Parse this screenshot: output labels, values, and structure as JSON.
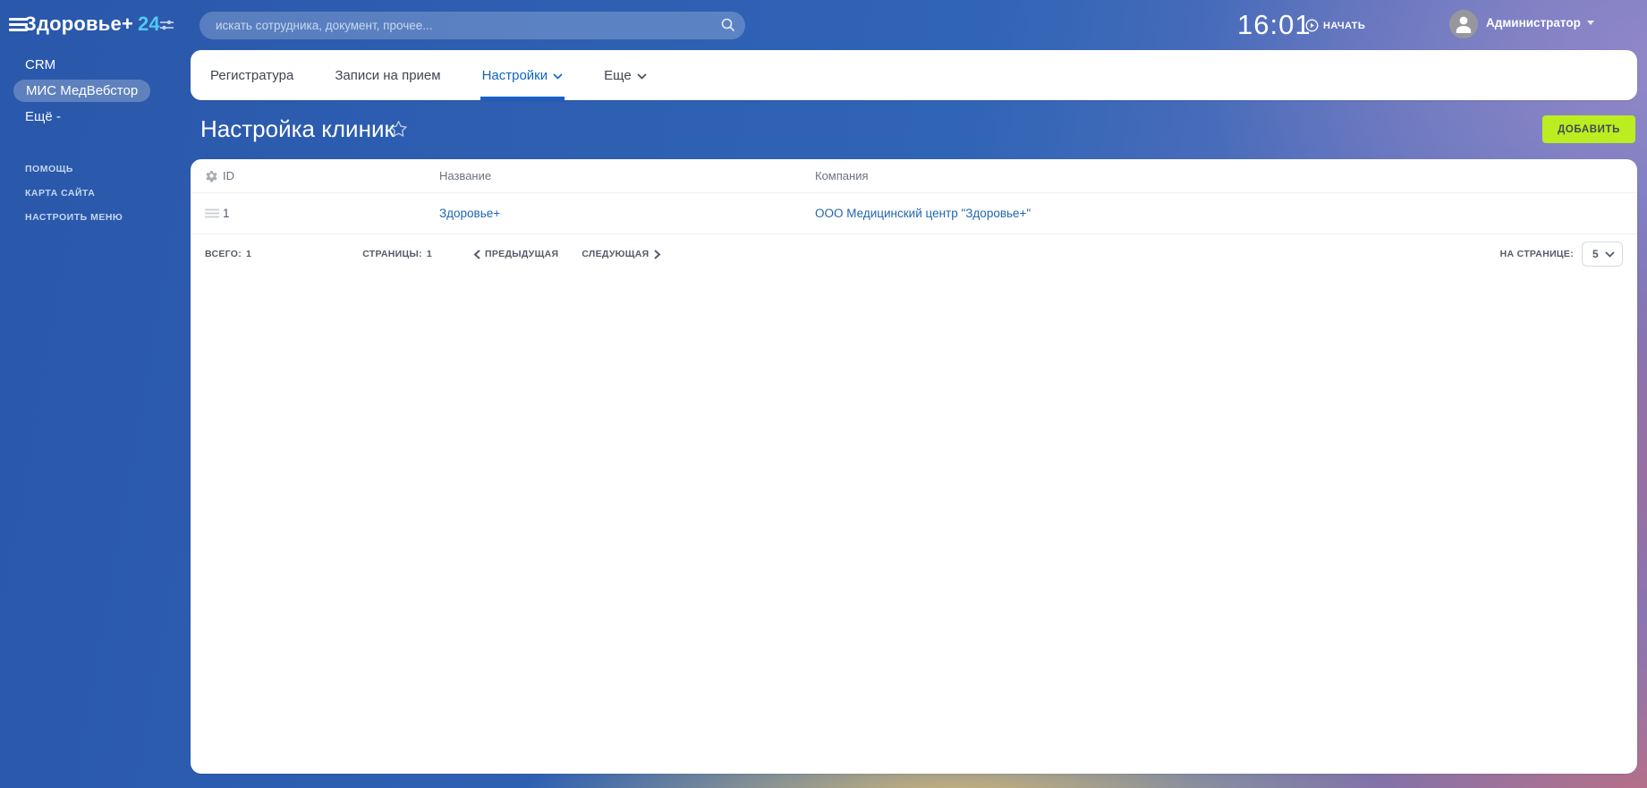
{
  "colors": {
    "accent_green": "#bbed21",
    "link_blue": "#2066b0",
    "tab_active_blue": "#0f66c2"
  },
  "header": {
    "logo_text": "Здоровье+",
    "logo_suffix": "24",
    "search_placeholder": "искать сотрудника, документ, прочее...",
    "clock": "16:01",
    "start_label": "НАЧАТЬ",
    "user_name": "Администратор"
  },
  "sidebar": {
    "items": [
      {
        "label": "CRM"
      },
      {
        "label": "МИС МедВебстор"
      },
      {
        "label": "Ещё -"
      }
    ],
    "footer_items": [
      {
        "label": "ПОМОЩЬ"
      },
      {
        "label": "КАРТА САЙТА"
      },
      {
        "label": "НАСТРОИТЬ МЕНЮ"
      }
    ]
  },
  "tabs": [
    {
      "label": "Регистратура"
    },
    {
      "label": "Записи на прием"
    },
    {
      "label": "Настройки"
    },
    {
      "label": "Еще"
    }
  ],
  "page": {
    "title": "Настройка клиник",
    "add_button_label": "ДОБАВИТЬ"
  },
  "grid": {
    "columns": {
      "id": "ID",
      "name": "Название",
      "company": "Компания"
    },
    "rows": [
      {
        "id": "1",
        "name": "Здоровье+",
        "company": "ООО Медицинский центр \"Здоровье+\""
      }
    ]
  },
  "pagination": {
    "total_label": "ВСЕГО:",
    "total_value": "1",
    "pages_label": "СТРАНИЦЫ:",
    "pages_value": "1",
    "prev_label": "ПРЕДЫДУЩАЯ",
    "next_label": "СЛЕДУЮЩАЯ",
    "per_page_label": "НА СТРАНИЦЕ:",
    "per_page_value": "5"
  }
}
